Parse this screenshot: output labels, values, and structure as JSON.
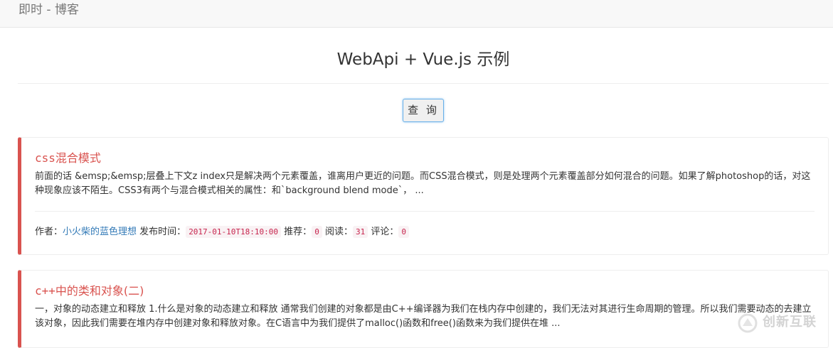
{
  "navbar": {
    "brand": "即时 - 博客"
  },
  "header": {
    "title": "WebApi + Vue.js 示例"
  },
  "toolbar": {
    "query_label": "查 询"
  },
  "posts": [
    {
      "title_code": "css",
      "title_rest": "混合模式",
      "summary": "前面的话 &emsp;&emsp;层叠上下文z index只是解决两个元素覆盖，谁离用户更近的问题。而CSS混合模式，则是处理两个元素覆盖部分如何混合的问题。如果了解photoshop的话，对这种现象应该不陌生。CSS3有两个与混合模式相关的属性：和`background blend mode`， ...",
      "meta": {
        "author_label": "作者：",
        "author": "小火柴的蓝色理想",
        "publish_label": "发布时间：",
        "publish_time": "2017-01-10T18:10:00",
        "recommend_label": "推荐：",
        "recommend": "0",
        "read_label": "阅读：",
        "read": "31",
        "comment_label": "评论：",
        "comment": "0"
      }
    },
    {
      "title_code": "c++",
      "title_rest": "中的类和对象(二)",
      "summary": "一，对象的动态建立和释放 1.什么是对象的动态建立和释放 通常我们创建的对象都是由C++编译器为我们在栈内存中创建的，我们无法对其进行生命周期的管理。所以我们需要动态的去建立该对象，因此我们需要在堆内存中创建对象和释放对象。在C语言中为我们提供了malloc()函数和free()函数来为我们提供在堆 ..."
    }
  ],
  "watermark": {
    "text": "创新互联"
  },
  "colors": {
    "accent": "#d9534f",
    "link": "#337ab7",
    "code_text": "#c7254e",
    "code_bg": "#f9f2f4"
  }
}
